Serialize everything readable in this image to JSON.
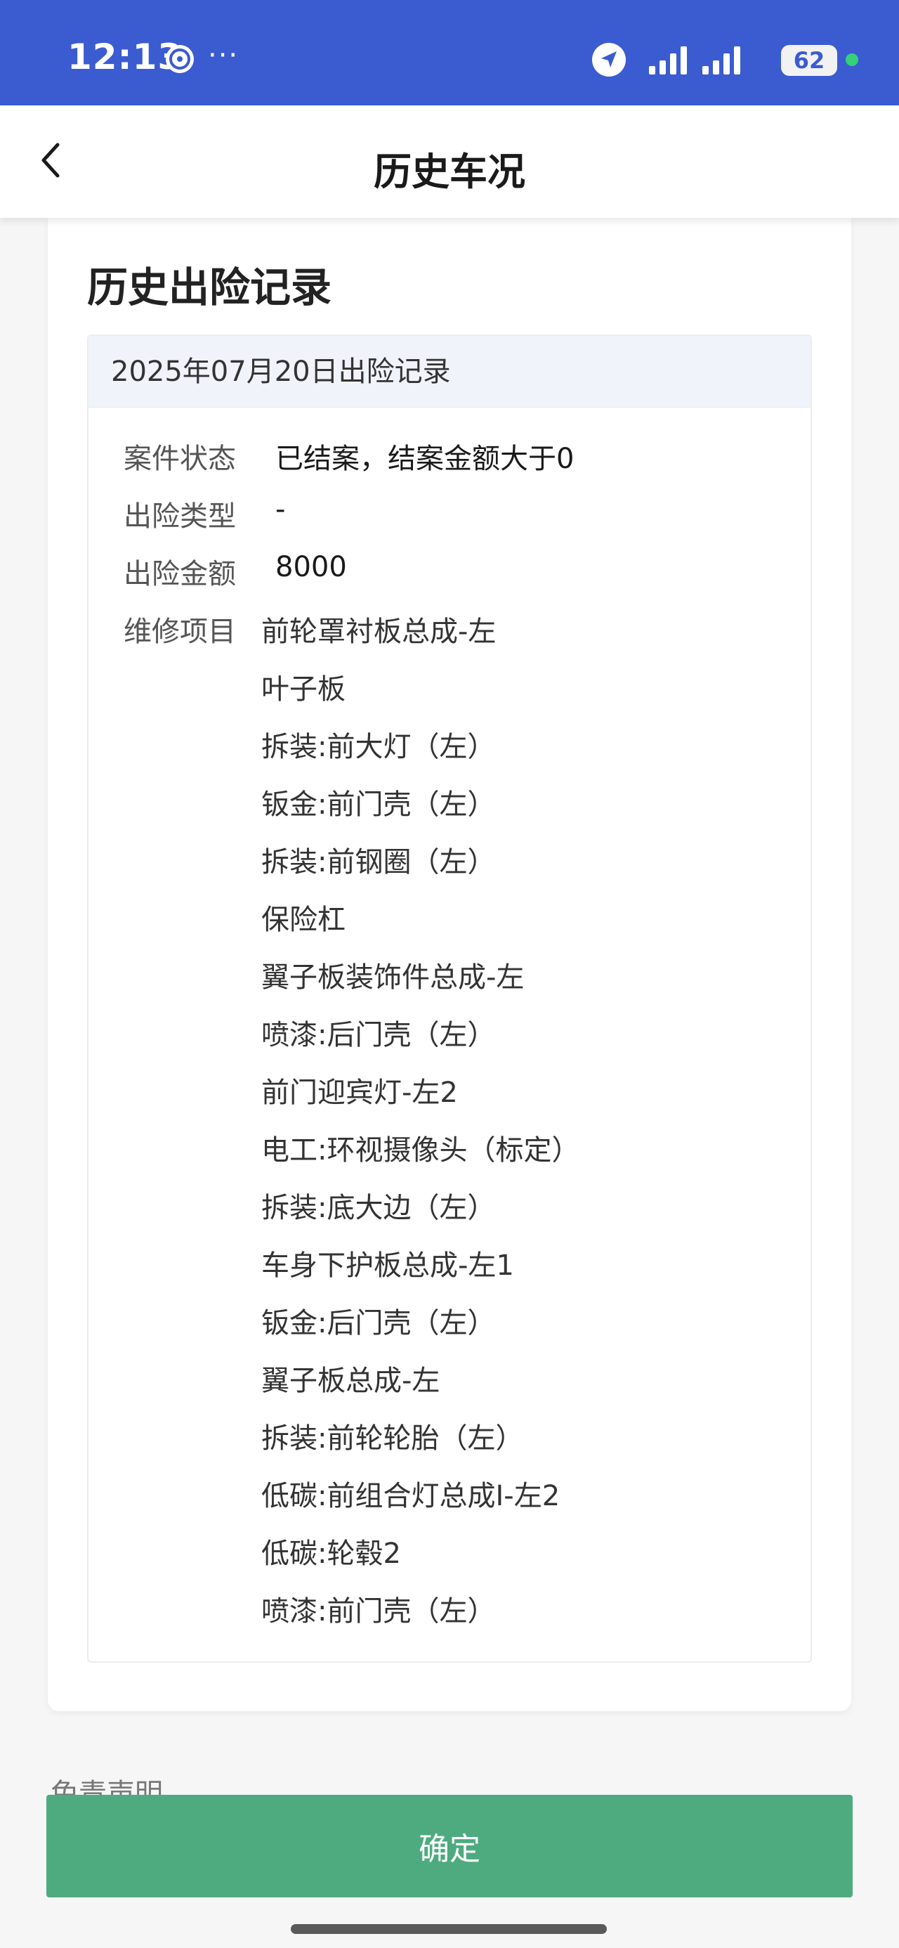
{
  "status_bar": {
    "time": "12:13",
    "dots": "···",
    "battery": "62",
    "icons": [
      "app-icon",
      "location-arrow-icon",
      "signal-icon",
      "signal-icon",
      "battery-icon"
    ]
  },
  "nav": {
    "title": "历史车况",
    "back_icon": "chevron-left-icon"
  },
  "section": {
    "title": "历史出险记录",
    "record": {
      "header": "2025年07月20日出险记录",
      "fields": [
        {
          "label": "案件状态",
          "value": "已结案，结案金额大于0"
        },
        {
          "label": "出险类型",
          "value": "-"
        },
        {
          "label": "出险金额",
          "value": "8000"
        },
        {
          "label": "维修项目",
          "value": ""
        }
      ],
      "repair_items": [
        "前轮罩衬板总成-左",
        "叶子板",
        "拆装:前大灯（左）",
        "钣金:前门壳（左）",
        "拆装:前钢圈（左）",
        "保险杠",
        "翼子板装饰件总成-左",
        "喷漆:后门壳（左）",
        "前门迎宾灯-左2",
        "电工:环视摄像头（标定）",
        "拆装:底大边（左）",
        "车身下护板总成-左1",
        "钣金:后门壳（左）",
        "翼子板总成-左",
        "拆装:前轮轮胎（左）",
        "低碳:前组合灯总成I-左2",
        "低碳:轮毂2",
        "喷漆:前门壳（左）"
      ]
    }
  },
  "footer": {
    "partial_label": "免责声明",
    "confirm_label": "确定"
  },
  "colors": {
    "status_bar": "#3b5bd0",
    "confirm_button": "#4dab7f",
    "record_header_bg": "#f1f3fb"
  }
}
